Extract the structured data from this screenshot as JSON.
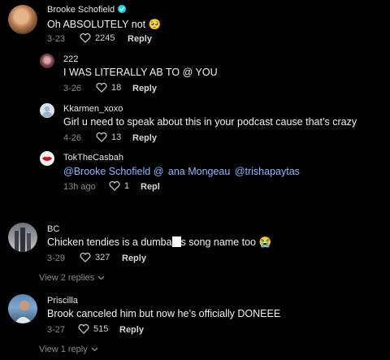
{
  "comments": [
    {
      "username": "Brooke Schofield",
      "verified": true,
      "text": "Oh ABSOLUTELY not",
      "emoji": "🥺",
      "date": "3-23",
      "likes": "2245",
      "reply_label": "Reply",
      "replies": [
        {
          "username": "222",
          "text": "I WAS LITERALLY AB TO @ YOU",
          "date": "3-26",
          "likes": "18",
          "reply_label": "Reply"
        },
        {
          "username": "Kkarmen_xoxo",
          "text": "Girl u need to speak about this in your podcast cause that’s crazy",
          "date": "4-26",
          "likes": "13",
          "reply_label": "Reply"
        },
        {
          "username": "TokTheCasbah",
          "mentions": [
            "@Brooke Schofield",
            "@",
            "ana Mongeau",
            "@trishapaytas"
          ],
          "date": "13h ago",
          "likes": "1",
          "reply_label": "Repl"
        }
      ]
    },
    {
      "username": "BC",
      "text_before": "Chicken tendies is a dumba",
      "text_after": "s song name too",
      "emoji": "😭",
      "date": "3-29",
      "likes": "327",
      "reply_label": "Reply",
      "view_replies": "View 2 replies"
    },
    {
      "username": "Priscilla",
      "text": "Brook canceled him but now he’s officially DONEEE",
      "date": "3-27",
      "likes": "515",
      "reply_label": "Reply",
      "view_replies": "View 1 reply"
    }
  ],
  "colors": {
    "background": "#000000",
    "secondary_text": "#8a8a8a",
    "mention": "#8fb4ff",
    "verified_badge": "#20d5ec"
  }
}
